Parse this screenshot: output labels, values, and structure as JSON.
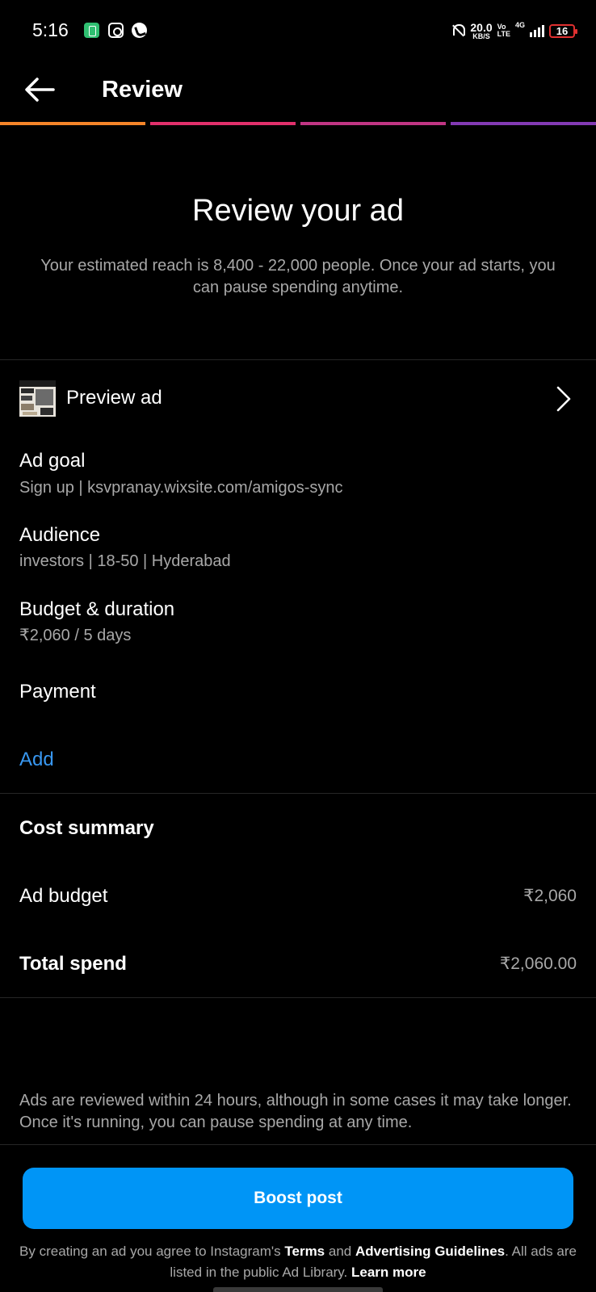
{
  "status_bar": {
    "time": "5:16",
    "net_speed_value": "20.0",
    "net_speed_unit": "KB/S",
    "volte_top": "Vo",
    "volte_bottom": "LTE",
    "network": "4G",
    "battery": "16"
  },
  "header": {
    "title": "Review"
  },
  "progress_colors": [
    "#f58529",
    "#e1306c",
    "#c13584",
    "#833ab4"
  ],
  "hero": {
    "title": "Review your ad",
    "subtitle": "Your estimated reach is 8,400 - 22,000 people. Once your ad starts, you can pause spending anytime."
  },
  "preview": {
    "label": "Preview ad"
  },
  "sections": {
    "ad_goal": {
      "title": "Ad goal",
      "value": "Sign up | ksvpranay.wixsite.com/amigos-sync"
    },
    "audience": {
      "title": "Audience",
      "value": "investors | 18-50 | Hyderabad"
    },
    "budget": {
      "title": "Budget & duration",
      "value": "₹2,060 / 5 days"
    },
    "payment": {
      "title": "Payment",
      "action": "Add"
    }
  },
  "cost_summary": {
    "title": "Cost summary",
    "rows": [
      {
        "label": "Ad budget",
        "value": "₹2,060"
      },
      {
        "label": "Total spend",
        "value": "₹2,060.00"
      }
    ]
  },
  "footnote": "Ads are reviewed within 24 hours, although in some cases it may take longer. Once it's running, you can pause spending at any time.",
  "boost_button": "Boost post",
  "legal": {
    "part1": "By creating an ad you agree to Instagram's ",
    "terms": "Terms",
    "part2": " and ",
    "guidelines": "Advertising Guidelines",
    "part3": ". All ads are listed in the public Ad Library. ",
    "learn_more": "Learn more"
  },
  "colors": {
    "accent": "#0095f6",
    "link": "#3897f0",
    "secondary_text": "#a8a8a8"
  }
}
